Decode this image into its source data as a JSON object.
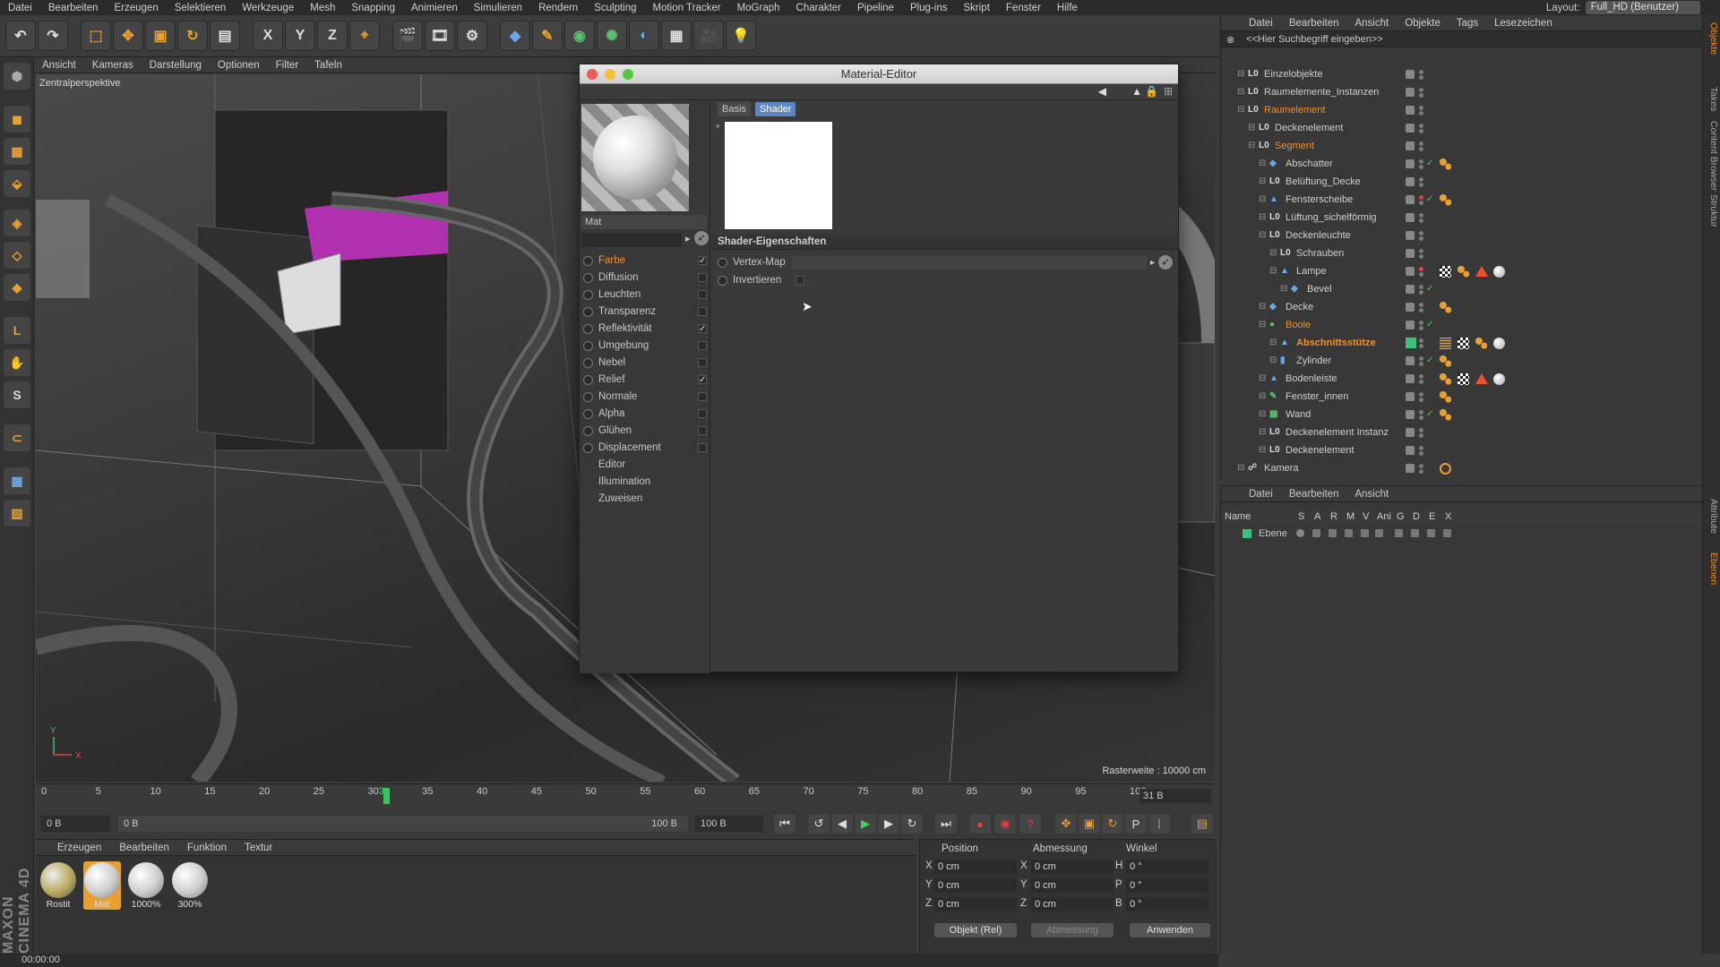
{
  "menubar": {
    "items": [
      "Datei",
      "Bearbeiten",
      "Erzeugen",
      "Selektieren",
      "Werkzeuge",
      "Mesh",
      "Snapping",
      "Animieren",
      "Simulieren",
      "Rendern",
      "Sculpting",
      "Motion Tracker",
      "MoGraph",
      "Charakter",
      "Pipeline",
      "Plug-ins",
      "Skript",
      "Fenster",
      "Hilfe"
    ],
    "layout_label": "Layout:",
    "layout_value": "Full_HD (Benutzer)"
  },
  "toolbar": {
    "axis_x": "X",
    "axis_y": "Y",
    "axis_z": "Z"
  },
  "viewport": {
    "menu": [
      "Ansicht",
      "Kameras",
      "Darstellung",
      "Optionen",
      "Filter",
      "Tafeln"
    ],
    "label": "Zentralperspektive",
    "raster": "Rasterweite : 10000 cm"
  },
  "timeline": {
    "ticks": [
      "0",
      "5",
      "10",
      "15",
      "20",
      "25",
      "30",
      "31",
      "35",
      "40",
      "45",
      "50",
      "55",
      "60",
      "65",
      "70",
      "75",
      "80",
      "85",
      "90",
      "95",
      "100"
    ],
    "frame_end": "31 B",
    "start": "0 B",
    "range_start": "0 B",
    "range_end": "100 B",
    "end": "100 B"
  },
  "material_manager": {
    "menu": [
      "Erzeugen",
      "Bearbeiten",
      "Funktion",
      "Textur"
    ],
    "materials": [
      {
        "name": "Rostit",
        "selected": false
      },
      {
        "name": "Mat",
        "selected": true
      },
      {
        "name": "1000%",
        "selected": false
      },
      {
        "name": "300%",
        "selected": false
      }
    ]
  },
  "coords": {
    "headers": [
      "Position",
      "Abmessung",
      "Winkel"
    ],
    "rows": [
      {
        "a": "X",
        "pos": "0 cm",
        "b": "X",
        "size": "0 cm",
        "c": "H",
        "rot": "0 °"
      },
      {
        "a": "Y",
        "pos": "0 cm",
        "b": "Y",
        "size": "0 cm",
        "c": "P",
        "rot": "0 °"
      },
      {
        "a": "Z",
        "pos": "0 cm",
        "b": "Z",
        "size": "0 cm",
        "c": "B",
        "rot": "0 °"
      }
    ],
    "mode": "Objekt (Rel)",
    "size_mode": "Abmessung",
    "apply": "Anwenden"
  },
  "status": {
    "time": "00:00:00"
  },
  "brand": "MAXON CINEMA 4D",
  "material_editor": {
    "title": "Material-Editor",
    "mat_name": "Mat",
    "channels": [
      {
        "name": "Farbe",
        "checked": true,
        "active": true
      },
      {
        "name": "Diffusion",
        "checked": false
      },
      {
        "name": "Leuchten",
        "checked": false
      },
      {
        "name": "Transparenz",
        "checked": false
      },
      {
        "name": "Reflektivität",
        "checked": true
      },
      {
        "name": "Umgebung",
        "checked": false
      },
      {
        "name": "Nebel",
        "checked": false
      },
      {
        "name": "Relief",
        "checked": true
      },
      {
        "name": "Normale",
        "checked": false
      },
      {
        "name": "Alpha",
        "checked": false
      },
      {
        "name": "Glühen",
        "checked": false
      },
      {
        "name": "Displacement",
        "checked": false
      },
      {
        "name": "Editor",
        "plain": true
      },
      {
        "name": "Illumination",
        "plain": true
      },
      {
        "name": "Zuweisen",
        "plain": true
      }
    ],
    "tabs": [
      "Basis",
      "Shader"
    ],
    "active_tab": "Shader",
    "section": "Shader-Eigenschaften",
    "props": {
      "vertex_map": "Vertex-Map",
      "invert": "Invertieren"
    }
  },
  "object_manager": {
    "menu": [
      "Datei",
      "Bearbeiten",
      "Ansicht",
      "Objekte",
      "Tags",
      "Lesezeichen"
    ],
    "search_placeholder": "<<Hier Suchbegriff eingeben>>",
    "objects": [
      {
        "name": "Einzelobjekte",
        "indent": 0,
        "type": "null"
      },
      {
        "name": "Raumelemente_Instanzen",
        "indent": 0,
        "type": "null"
      },
      {
        "name": "Raumelement",
        "indent": 0,
        "type": "null",
        "highlight": true
      },
      {
        "name": "Deckenelement",
        "indent": 1,
        "type": "null"
      },
      {
        "name": "Segment",
        "indent": 1,
        "type": "null",
        "highlight": true
      },
      {
        "name": "Abschatter",
        "indent": 2,
        "type": "poly"
      },
      {
        "name": "Belüftung_Decke",
        "indent": 2,
        "type": "null"
      },
      {
        "name": "Fensterscheibe",
        "indent": 2,
        "type": "tri"
      },
      {
        "name": "Lüftung_sichelförmig",
        "indent": 2,
        "type": "null"
      },
      {
        "name": "Deckenleuchte",
        "indent": 2,
        "type": "null"
      },
      {
        "name": "Schrauben",
        "indent": 3,
        "type": "null"
      },
      {
        "name": "Lampe",
        "indent": 3,
        "type": "tri"
      },
      {
        "name": "Bevel",
        "indent": 4,
        "type": "poly"
      },
      {
        "name": "Decke",
        "indent": 2,
        "type": "poly"
      },
      {
        "name": "Boole",
        "indent": 2,
        "type": "boole",
        "highlight": true
      },
      {
        "name": "Abschnittsstütze",
        "indent": 3,
        "type": "tri",
        "highlight": true,
        "bold": true
      },
      {
        "name": "Zylinder",
        "indent": 3,
        "type": "cyl"
      },
      {
        "name": "Bodenleiste",
        "indent": 2,
        "type": "tri"
      },
      {
        "name": "Fenster_innen",
        "indent": 2,
        "type": "spline"
      },
      {
        "name": "Wand",
        "indent": 2,
        "type": "green"
      },
      {
        "name": "Deckenelement Instanz",
        "indent": 2,
        "type": "null"
      },
      {
        "name": "Deckenelement",
        "indent": 2,
        "type": "null"
      },
      {
        "name": "Kamera",
        "indent": 0,
        "type": "cam"
      }
    ]
  },
  "layer_manager": {
    "menu": [
      "Datei",
      "Bearbeiten",
      "Ansicht"
    ],
    "columns": [
      "Name",
      "S",
      "A",
      "R",
      "M",
      "V",
      "Ani",
      "G",
      "D",
      "E",
      "X"
    ],
    "layers": [
      {
        "name": "Ebene",
        "color": "#3ec080"
      }
    ]
  },
  "side_tabs": [
    "Objekte",
    "Takes",
    "Content Browser",
    "Struktur",
    "Attribute",
    "Ebenen"
  ],
  "colors": {
    "accent": "#f09030",
    "playhead": "#3ec060"
  }
}
